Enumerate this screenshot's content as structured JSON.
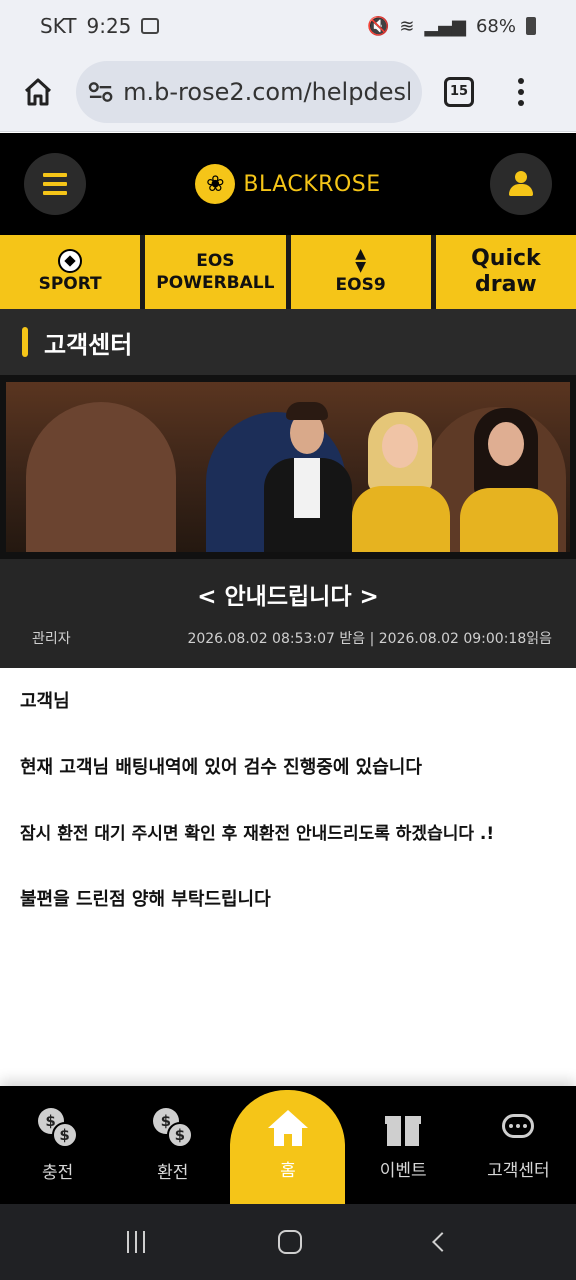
{
  "status_bar": {
    "carrier": "SKT",
    "time": "9:25",
    "battery": "68%"
  },
  "browser": {
    "url": "m.b-rose2.com/helpdesk",
    "tab_count": "15"
  },
  "header": {
    "brand": "BLACKROSE"
  },
  "game_tabs": [
    {
      "label": "SPORT",
      "icon": "soccer-ball-icon"
    },
    {
      "label_top": "EOS",
      "label": "POWERBALL"
    },
    {
      "label": "EOS9",
      "icon": "up-down-arrows-icon"
    },
    {
      "label_top": "Quick",
      "label": "draw"
    }
  ],
  "section": {
    "title": "고객센터"
  },
  "notice": {
    "title": "< 안내드립니다 >",
    "author": "관리자",
    "meta": "2026.08.02 08:53:07 받음 | 2026.08.02 09:00:18읽음"
  },
  "content": {
    "lines": [
      "고객님",
      "현재 고객님 배팅내역에 있어 검수 진행중에 있습니다",
      "잠시 환전 대기 주시면 확인 후 재환전 안내드리도록 하겠습니다 .!",
      "불편을 드린점 양해 부탁드립니다"
    ]
  },
  "bottom_nav": [
    {
      "label": "충전",
      "icon": "coins-icon"
    },
    {
      "label": "환전",
      "icon": "coins-icon"
    },
    {
      "label": "홈",
      "icon": "home-icon",
      "active": true
    },
    {
      "label": "이벤트",
      "icon": "gift-icon"
    },
    {
      "label": "고객센터",
      "icon": "support-chat-icon"
    }
  ],
  "colors": {
    "accent": "#f5c518",
    "header_bg": "#000000",
    "panel_bg": "#262626"
  }
}
